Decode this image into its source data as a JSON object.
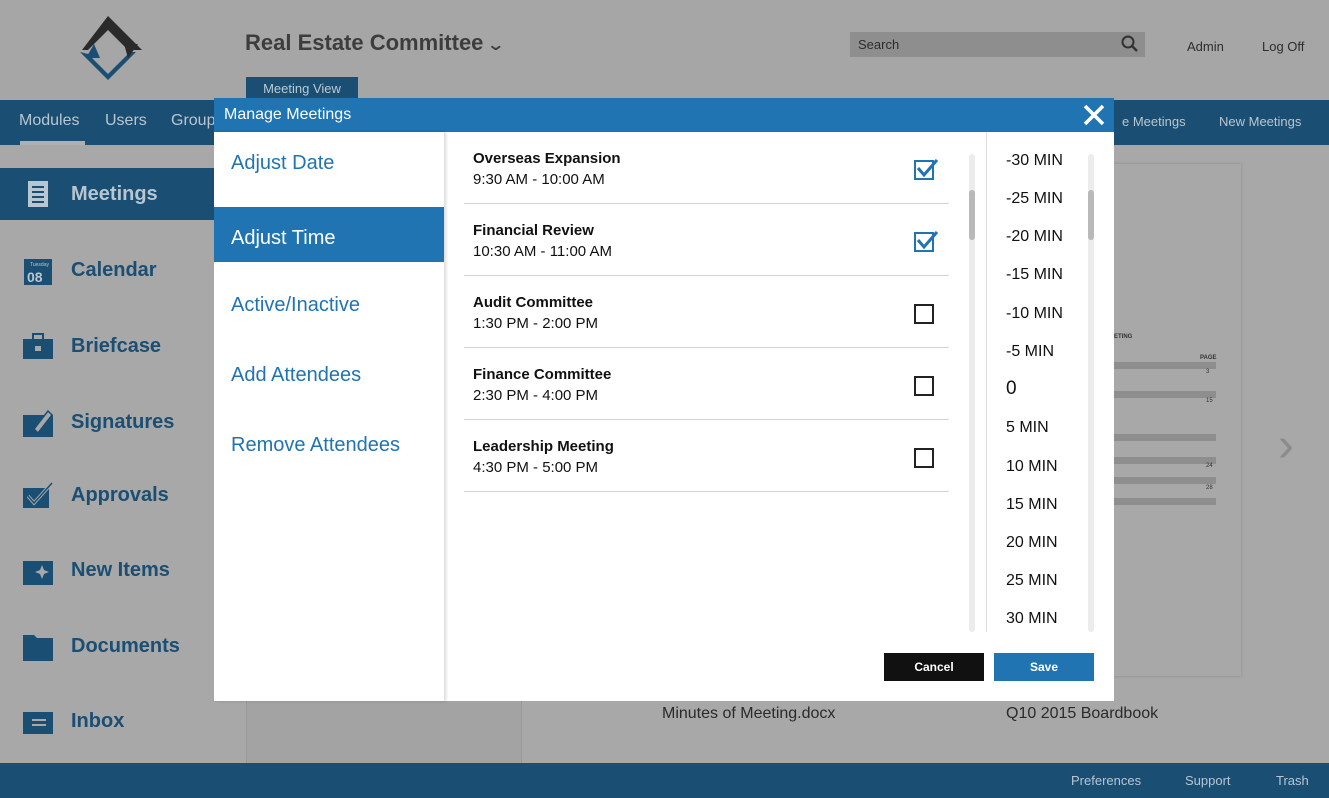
{
  "header": {
    "committee": "Real Estate Committee",
    "search_placeholder": "Search",
    "admin": "Admin",
    "logoff": "Log Off",
    "meeting_view_tab": "Meeting View"
  },
  "nav": {
    "items": [
      "Modules",
      "Users",
      "Group"
    ],
    "right_items": [
      "e Meetings",
      "New Meetings"
    ]
  },
  "sidebar": {
    "items": [
      {
        "label": "Meetings",
        "icon": "meetings-icon"
      },
      {
        "label": "Calendar",
        "icon": "calendar-icon",
        "day": "Tuesday",
        "date": "08"
      },
      {
        "label": "Briefcase",
        "icon": "briefcase-icon"
      },
      {
        "label": "Signatures",
        "icon": "signature-icon"
      },
      {
        "label": "Approvals",
        "icon": "approval-icon"
      },
      {
        "label": "New Items",
        "icon": "new-items-icon"
      },
      {
        "label": "Documents",
        "icon": "folder-icon"
      },
      {
        "label": "Inbox",
        "icon": "inbox-icon"
      }
    ]
  },
  "background": {
    "file1": "Minutes of Meeting.docx",
    "file2": "Q10 2015 Boardbook",
    "doc_texts": [
      "ETING",
      "PAGE",
      "3",
      "15",
      "24",
      "28"
    ]
  },
  "footer": {
    "preferences": "Preferences",
    "support": "Support",
    "trash": "Trash"
  },
  "modal": {
    "title": "Manage Meetings",
    "menu": [
      {
        "label": "Adjust Date",
        "active": false
      },
      {
        "label": "Adjust Time",
        "active": true
      },
      {
        "label": "Active/Inactive",
        "active": false
      },
      {
        "label": "Add Attendees",
        "active": false
      },
      {
        "label": "Remove Attendees",
        "active": false
      }
    ],
    "meetings": [
      {
        "name": "Overseas Expansion",
        "time": "9:30 AM - 10:00 AM",
        "checked": true
      },
      {
        "name": "Financial Review",
        "time": "10:30 AM - 11:00 AM",
        "checked": true
      },
      {
        "name": "Audit Committee",
        "time": "1:30 PM - 2:00 PM",
        "checked": false
      },
      {
        "name": "Finance Committee",
        "time": "2:30 PM - 4:00 PM",
        "checked": false
      },
      {
        "name": "Leadership Meeting",
        "time": "4:30 PM - 5:00 PM",
        "checked": false
      }
    ],
    "time_offsets": [
      "-30 MIN",
      "-25 MIN",
      "-20 MIN",
      "-15 MIN",
      "-10 MIN",
      "-5 MIN",
      "0",
      "5 MIN",
      "10 MIN",
      "15 MIN",
      "20 MIN",
      "25 MIN",
      "30 MIN"
    ],
    "selected_offset": "0",
    "cancel": "Cancel",
    "save": "Save"
  },
  "colors": {
    "accent": "#1f74b1",
    "nav_dark": "#1a4e72"
  }
}
